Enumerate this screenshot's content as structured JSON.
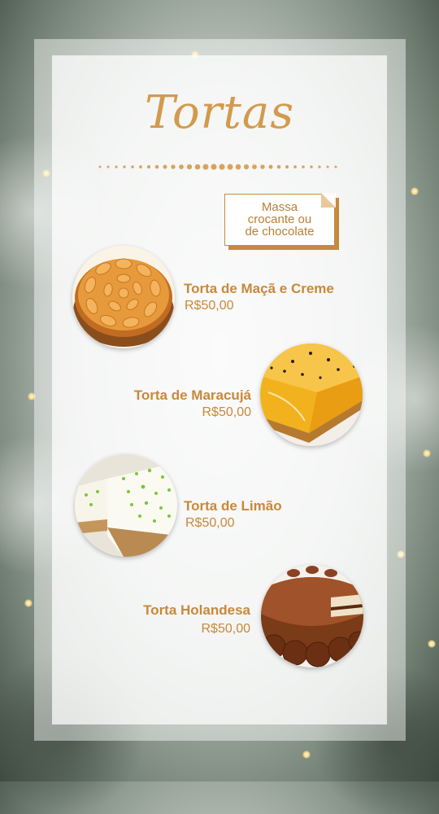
{
  "title": "Tortas",
  "note": {
    "line1": "Massa",
    "line2": "crocante ou",
    "line3": "de chocolate"
  },
  "colors": {
    "accent": "#c8883a",
    "title": "#d39a4d"
  },
  "items": [
    {
      "name": "Torta de Maçã e Creme",
      "price": "R$50,00",
      "image": "apple-pie"
    },
    {
      "name": "Torta de Maracujá",
      "price": "R$50,00",
      "image": "passion-fruit-pie"
    },
    {
      "name": "Torta de Limão",
      "price": "R$50,00",
      "image": "lime-pie"
    },
    {
      "name": "Torta Holandesa",
      "price": "R$50,00",
      "image": "dutch-pie"
    }
  ]
}
